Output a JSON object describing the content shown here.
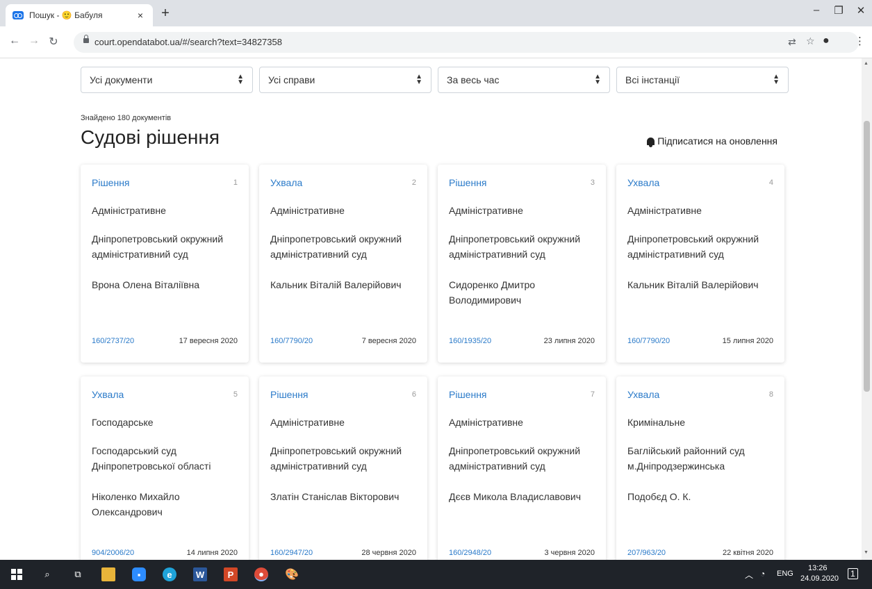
{
  "browser": {
    "tab_title": "Пошук - 🙂 Бабуля",
    "tab_close": "×",
    "new_tab": "+",
    "url": "court.opendatabot.ua/#/search?text=34827358",
    "window_minimize": "–",
    "window_restore": "❐",
    "window_close": "✕"
  },
  "filters": [
    {
      "label": "Усі документи"
    },
    {
      "label": "Усі справи"
    },
    {
      "label": "За весь час"
    },
    {
      "label": "Всі інстанції"
    }
  ],
  "results": {
    "found_text": "Знайдено 180 документів",
    "heading": "Судові рішення",
    "subscribe_label": "Підписатися на оновлення"
  },
  "cards": [
    {
      "type": "Рішення",
      "num": "1",
      "jurisdiction": "Адміністративне",
      "court": "Дніпропетровський окружний адміністративний суд",
      "judge": "Врона Олена Віталіївна",
      "case": "160/2737/20",
      "date": "17 вересня 2020"
    },
    {
      "type": "Ухвала",
      "num": "2",
      "jurisdiction": "Адміністративне",
      "court": "Дніпропетровський окружний адміністративний суд",
      "judge": "Кальник Віталій Валерійович",
      "case": "160/7790/20",
      "date": "7 вересня 2020"
    },
    {
      "type": "Рішення",
      "num": "3",
      "jurisdiction": "Адміністративне",
      "court": "Дніпропетровський окружний адміністративний суд",
      "judge": "Сидоренко Дмитро Володимирович",
      "case": "160/1935/20",
      "date": "23 липня 2020"
    },
    {
      "type": "Ухвала",
      "num": "4",
      "jurisdiction": "Адміністративне",
      "court": "Дніпропетровський окружний адміністративний суд",
      "judge": "Кальник Віталій Валерійович",
      "case": "160/7790/20",
      "date": "15 липня 2020"
    },
    {
      "type": "Ухвала",
      "num": "5",
      "jurisdiction": "Господарське",
      "court": "Господарський суд Дніпропетровської області",
      "judge": "Ніколенко Михайло Олександрович",
      "case": "904/2006/20",
      "date": "14 липня 2020"
    },
    {
      "type": "Рішення",
      "num": "6",
      "jurisdiction": "Адміністративне",
      "court": "Дніпропетровський окружний адміністративний суд",
      "judge": "Златін Станіслав Вікторович",
      "case": "160/2947/20",
      "date": "28 червня 2020"
    },
    {
      "type": "Рішення",
      "num": "7",
      "jurisdiction": "Адміністративне",
      "court": "Дніпропетровський окружний адміністративний суд",
      "judge": "Дєєв Микола Владиславович",
      "case": "160/2948/20",
      "date": "3 червня 2020"
    },
    {
      "type": "Ухвала",
      "num": "8",
      "jurisdiction": "Кримінальне",
      "court": "Баглійський районний суд м.Дніпродзержинська",
      "judge": "Подобєд О. К.",
      "case": "207/963/20",
      "date": "22 квітня 2020"
    }
  ],
  "taskbar": {
    "lang": "ENG",
    "time": "13:26",
    "date": "24.09.2020",
    "notif_count": "1"
  },
  "colors": {
    "link": "#2a7ac9",
    "taskbar": "#1f2329"
  }
}
